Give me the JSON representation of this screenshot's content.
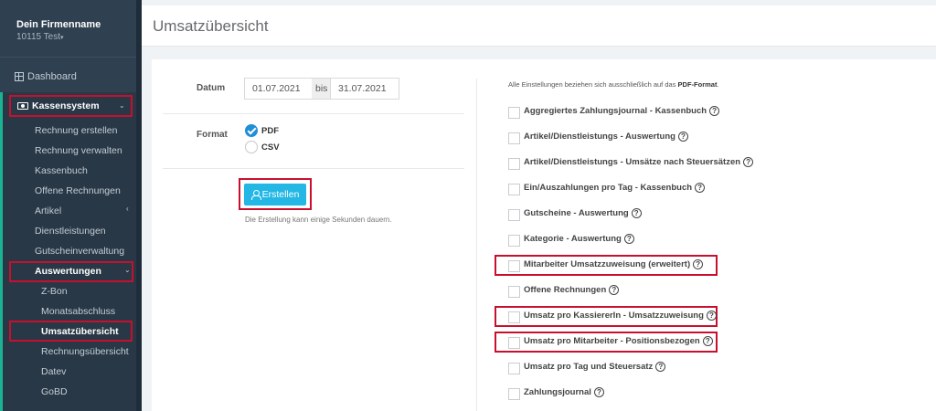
{
  "sidebar": {
    "company": "Dein Firmenname",
    "branch": "10115 Test",
    "dashboard": "Dashboard",
    "kassensystem": "Kassensystem",
    "items": [
      "Rechnung erstellen",
      "Rechnung verwalten",
      "Kassenbuch",
      "Offene Rechnungen",
      "Artikel",
      "Dienstleistungen",
      "Gutscheinverwaltung"
    ],
    "auswertungen": "Auswertungen",
    "sub_items": [
      "Z-Bon",
      "Monatsabschluss",
      "Umsatzübersicht",
      "Rechnungsübersicht",
      "Datev",
      "GoBD"
    ]
  },
  "header": {
    "title": "Umsatzübersicht"
  },
  "form": {
    "datum_label": "Datum",
    "date_from": "01.07.2021",
    "date_sep": "bis",
    "date_to": "31.07.2021",
    "format_label": "Format",
    "formats": [
      {
        "label": "PDF",
        "checked": true
      },
      {
        "label": "CSV",
        "checked": false
      }
    ],
    "button": "Erstellen",
    "hint": "Die Erstellung kann einige Sekunden dauern."
  },
  "settings": {
    "note_prefix": "Alle Einstellungen beziehen sich ausschließlich auf das ",
    "note_bold": "PDF-Format",
    "note_suffix": ".",
    "options": [
      "Aggregiertes Zahlungsjournal - Kassenbuch",
      "Artikel/Dienstleistungs - Auswertung",
      "Artikel/Dienstleistungs - Umsätze nach Steuersätzen",
      "Ein/Auszahlungen pro Tag - Kassenbuch",
      "Gutscheine - Auswertung",
      "Kategorie - Auswertung",
      "Mitarbeiter Umsatzzuweisung (erweitert)",
      "Offene Rechnungen",
      "Umsatz pro KassiererIn - Umsatzzuweisung",
      "Umsatz pro Mitarbeiter - Positionsbezogen",
      "Umsatz pro Tag und Steuersatz",
      "Zahlungsjournal"
    ]
  },
  "colors": {
    "sidebar": "#2f4050",
    "highlight": "#c8102e",
    "button": "#23b7e5",
    "radio_checked": "#1f8fd6"
  }
}
